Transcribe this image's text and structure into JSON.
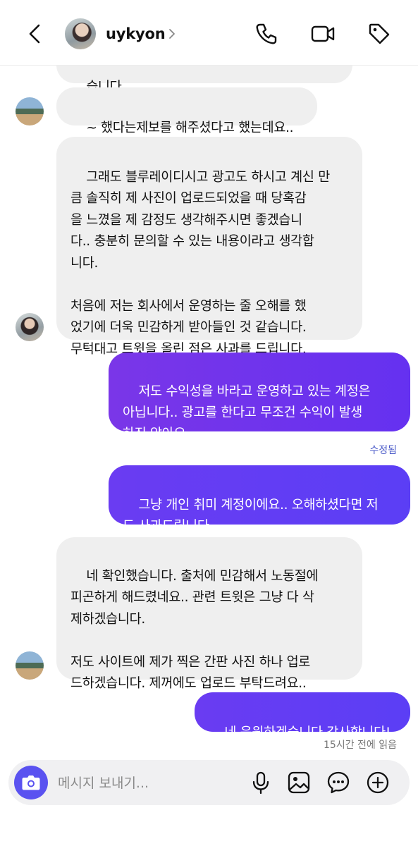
{
  "header": {
    "username": "uykyon",
    "icons": [
      "back-icon",
      "chevron-right-icon",
      "phone-icon",
      "video-icon",
      "tag-icon"
    ]
  },
  "messages": [
    {
      "from": "them",
      "text": "습니다.."
    },
    {
      "from": "them",
      "text": "~ 했다는제보를 해주셨다고 했는데요.."
    },
    {
      "from": "them",
      "text": "그래도 블루레이디시고 광고도 하시고 계신 만\n큼 솔직히 제 사진이 업로드되었을 때 당혹감\n을 느꼈을 제 감정도 생각해주시면 좋겠습니\n다.. 충분히 문의할 수 있는 내용이라고 생각합\n니다.\n\n처음에 저는 회사에서 운영하는 줄 오해를 했\n었기에 더욱 민감하게 받아들인 것 같습니다.\n무턱대고 트윗을 올린 점은 사과를 드립니다."
    },
    {
      "from": "me",
      "text": "저도 수익성을 바라고 운영하고 있는 계정은\n아닙니다.. 광고를 한다고 무조건 수익이 발생\n하진 않아요.."
    },
    {
      "from": "me",
      "text": "그냥 개인 취미 계정이에요.. 오해하셨다면 저\n도 사과드립니다",
      "status": "수정됨"
    },
    {
      "from": "them",
      "text": "네 확인했습니다. 출처에 민감해서 노동절에\n피곤하게 해드렸네요.. 관련 트윗은 그냥 다 삭\n제하겠습니다.\n\n저도 사이트에 제가 찍은 간판 사진 하나 업로\n드하겠습니다. 제꺼에도 업로드 부탁드려요.."
    },
    {
      "from": "me",
      "text": "네 응원하겠습니다 감사합니다!"
    }
  ],
  "read_receipt": "15시간 전에 읽음",
  "composer": {
    "placeholder": "메시지 보내기...",
    "icons": [
      "camera-icon",
      "microphone-icon",
      "gallery-icon",
      "sticker-chat-icon",
      "add-icon"
    ]
  },
  "colors": {
    "outgoing_bubble": "#6a34ee",
    "incoming_bubble": "#efefef",
    "camera_button": "#5a52f0",
    "edited_label": "#4a5ac8"
  }
}
